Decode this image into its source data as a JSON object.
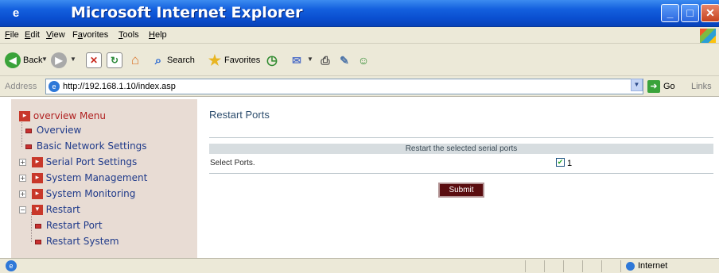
{
  "window": {
    "title": "Microsoft Internet Explorer"
  },
  "menu": [
    {
      "pre": "",
      "ul": "F",
      "post": "ile"
    },
    {
      "pre": "",
      "ul": "E",
      "post": "dit"
    },
    {
      "pre": "",
      "ul": "V",
      "post": "iew"
    },
    {
      "pre": "F",
      "ul": "a",
      "post": "vorites"
    },
    {
      "pre": "",
      "ul": "T",
      "post": "ools"
    },
    {
      "pre": "",
      "ul": "H",
      "post": "elp"
    }
  ],
  "toolbar": {
    "back_label": "Back",
    "search_label": "Search",
    "favorites_label": "Favorites"
  },
  "address": {
    "label": "Address",
    "url": "http://192.168.1.10/index.asp",
    "go_label": "Go",
    "links_label": "Links"
  },
  "sidebar": {
    "root": "overview Menu",
    "items": [
      {
        "label": "Overview"
      },
      {
        "label": "Basic Network Settings"
      },
      {
        "label": "Serial Port Settings"
      },
      {
        "label": "System Management"
      },
      {
        "label": "System Monitoring"
      },
      {
        "label": "Restart"
      },
      {
        "label": "Restart Port"
      },
      {
        "label": "Restart System"
      }
    ]
  },
  "main": {
    "title": "Restart Ports",
    "section_header": "Restart the selected serial ports",
    "select_label": "Select Ports.",
    "port_number": "1",
    "port_checked": true,
    "submit_label": "Submit"
  },
  "status": {
    "zone": "Internet"
  }
}
